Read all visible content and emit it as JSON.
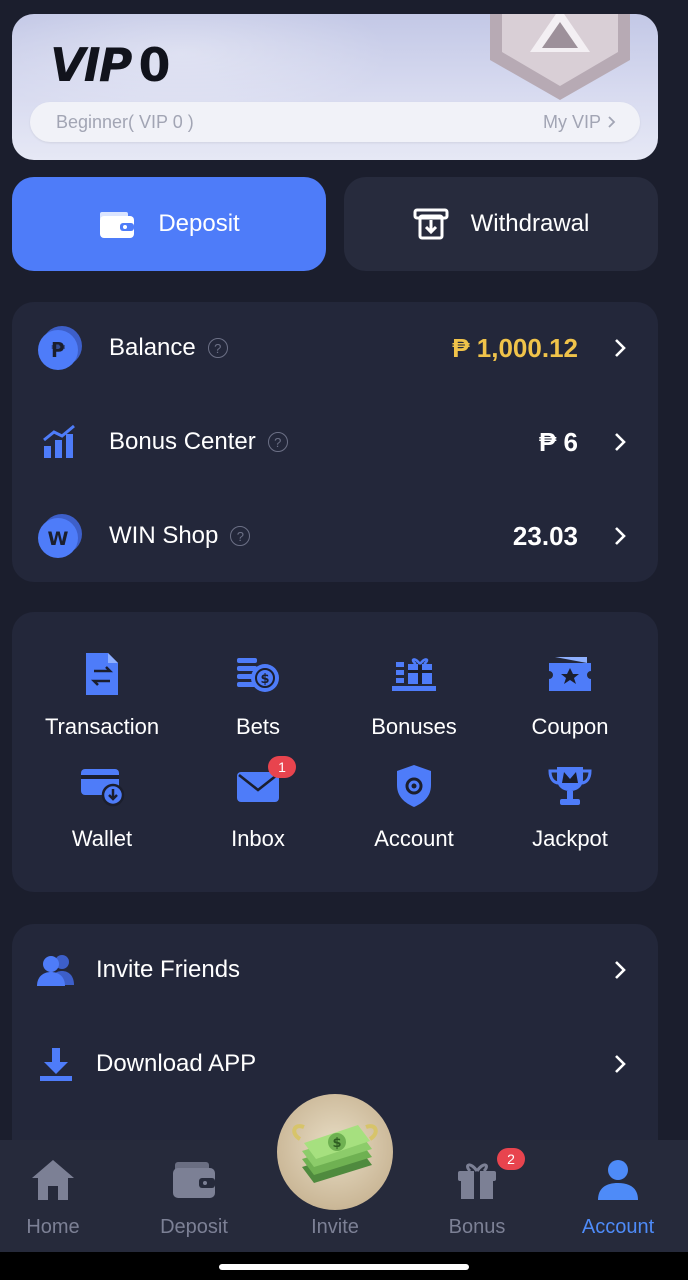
{
  "vip": {
    "title": "VIP",
    "level": "0",
    "status": "Beginner( VIP 0 )",
    "my_vip_label": "My VIP"
  },
  "actions": {
    "deposit_label": "Deposit",
    "withdraw_label": "Withdrawal"
  },
  "balances": [
    {
      "label": "Balance",
      "value": "₱ 1,000.12",
      "icon": "peso-coin-icon",
      "value_color": "#f0c34a"
    },
    {
      "label": "Bonus Center",
      "value": "₱ 6",
      "icon": "bar-chart-icon",
      "value_color": "#ffffff"
    },
    {
      "label": "WIN Shop",
      "value": "23.03",
      "icon": "w-coin-icon",
      "value_color": "#ffffff"
    }
  ],
  "grid": [
    {
      "label": "Transaction",
      "icon": "transaction-receipt-icon"
    },
    {
      "label": "Bets",
      "icon": "bets-coins-icon"
    },
    {
      "label": "Bonuses",
      "icon": "bonuses-gift-icon"
    },
    {
      "label": "Coupon",
      "icon": "coupon-ticket-icon"
    },
    {
      "label": "Wallet",
      "icon": "wallet-icon"
    },
    {
      "label": "Inbox",
      "icon": "inbox-mail-icon",
      "badge": "1"
    },
    {
      "label": "Account",
      "icon": "account-shield-icon"
    },
    {
      "label": "Jackpot",
      "icon": "jackpot-trophy-icon"
    }
  ],
  "links": [
    {
      "label": "Invite Friends",
      "icon": "users-icon"
    },
    {
      "label": "Download APP",
      "icon": "download-icon"
    }
  ],
  "nav": {
    "home": "Home",
    "deposit": "Deposit",
    "invite": "Invite",
    "bonus": "Bonus",
    "bonus_badge": "2",
    "account": "Account"
  },
  "colors": {
    "accent": "#4e7cf9",
    "gold": "#f0c34a",
    "background": "#1b1e2d",
    "panel": "#23273a",
    "badge": "#e8444e"
  }
}
